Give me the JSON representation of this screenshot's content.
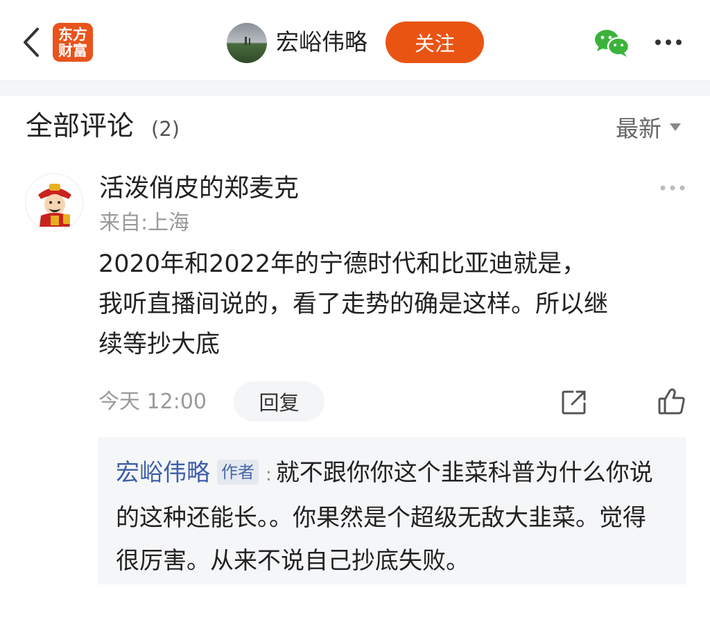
{
  "header": {
    "back_icon": "chevron-left-icon",
    "app_logo": [
      "东方",
      "财富"
    ],
    "author_name": "宏峪伟略",
    "follow_label": "关注",
    "share_wechat_icon": "wechat-icon",
    "more_icon": "more-horizontal-icon"
  },
  "comments_section": {
    "title": "全部评论",
    "count": "(2)",
    "sort_label": "最新"
  },
  "comment": {
    "user_name": "活泼俏皮的郑麦克",
    "location": "来自:上海",
    "lines": [
      "2020年和2022年的宁德时代和比亚迪就是，",
      "我听直播间说的，看了走势的确是这样。所以继",
      "续等抄大底"
    ],
    "time": "今天 12:00",
    "reply_label": "回复"
  },
  "reply": {
    "author": "宏峪伟略",
    "tag": "作者",
    "colon": ":",
    "text": "就不跟你你这个韭菜科普为什么你说的这种还能长。。你果然是个超级无敌大韭菜。觉得很厉害。从来不说自己抄底失败。"
  },
  "colors": {
    "brand_orange": "#ea5413",
    "reply_author_blue": "#3d5ea8",
    "muted_gray": "#9a9a9a",
    "wechat_green": "#3bb33b"
  }
}
